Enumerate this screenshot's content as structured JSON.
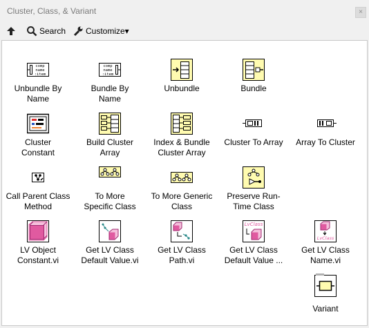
{
  "window": {
    "title": "Cluster, Class, & Variant",
    "close_glyph": "×"
  },
  "toolbar": {
    "up_icon": "up-arrow-icon",
    "search_label": "Search",
    "customize_label": "Customize▾"
  },
  "items": [
    {
      "name": "unbundle-by-name",
      "label": "Unbundle By\nName",
      "icon": "unbundle-by-name-icon"
    },
    {
      "name": "bundle-by-name",
      "label": "Bundle By\nName",
      "icon": "bundle-by-name-icon"
    },
    {
      "name": "unbundle",
      "label": "Unbundle",
      "icon": "unbundle-icon"
    },
    {
      "name": "bundle",
      "label": "Bundle",
      "icon": "bundle-icon"
    },
    {
      "name": "cluster-constant",
      "label": "Cluster\nConstant",
      "icon": "cluster-constant-icon"
    },
    {
      "name": "build-cluster-array",
      "label": "Build Cluster\nArray",
      "icon": "build-cluster-array-icon"
    },
    {
      "name": "index-bundle-cluster-array",
      "label": "Index & Bundle\nCluster Array",
      "icon": "index-bundle-icon"
    },
    {
      "name": "cluster-to-array",
      "label": "Cluster To Array",
      "icon": "cluster-to-array-icon"
    },
    {
      "name": "array-to-cluster",
      "label": "Array To Cluster",
      "icon": "array-to-cluster-icon"
    },
    {
      "name": "call-parent-class-method",
      "label": "Call Parent Class\nMethod",
      "icon": "call-parent-icon"
    },
    {
      "name": "to-more-specific-class",
      "label": "To More\nSpecific Class",
      "icon": "to-more-specific-icon"
    },
    {
      "name": "to-more-generic-class",
      "label": "To More Generic\nClass",
      "icon": "to-more-generic-icon"
    },
    {
      "name": "preserve-run-time-class",
      "label": "Preserve Run-\nTime Class",
      "icon": "preserve-runtime-icon"
    },
    {
      "name": "lv-object-constant",
      "label": "LV Object\nConstant.vi",
      "icon": "lv-object-icon"
    },
    {
      "name": "get-lv-class-default-value",
      "label": "Get LV Class\nDefault Value.vi",
      "icon": "get-default-value-icon"
    },
    {
      "name": "get-lv-class-path",
      "label": "Get LV Class\nPath.vi",
      "icon": "get-path-icon"
    },
    {
      "name": "get-lv-class-default-value-by-name",
      "label": "Get LV Class\nDefault Value ...",
      "icon": "get-default-value-by-name-icon"
    },
    {
      "name": "get-lv-class-name",
      "label": "Get LV Class\nName.vi",
      "icon": "get-name-icon"
    },
    {
      "name": "variant",
      "label": "Variant",
      "icon": "variant-icon"
    }
  ],
  "icon_texts": {
    "comp": "comp",
    "name": "name",
    "item": ":item",
    "lvclass": "LvClass"
  },
  "colors": {
    "pink": "#e05aa0",
    "yellow": "#fffbb0",
    "border": "#c8c8c8"
  }
}
